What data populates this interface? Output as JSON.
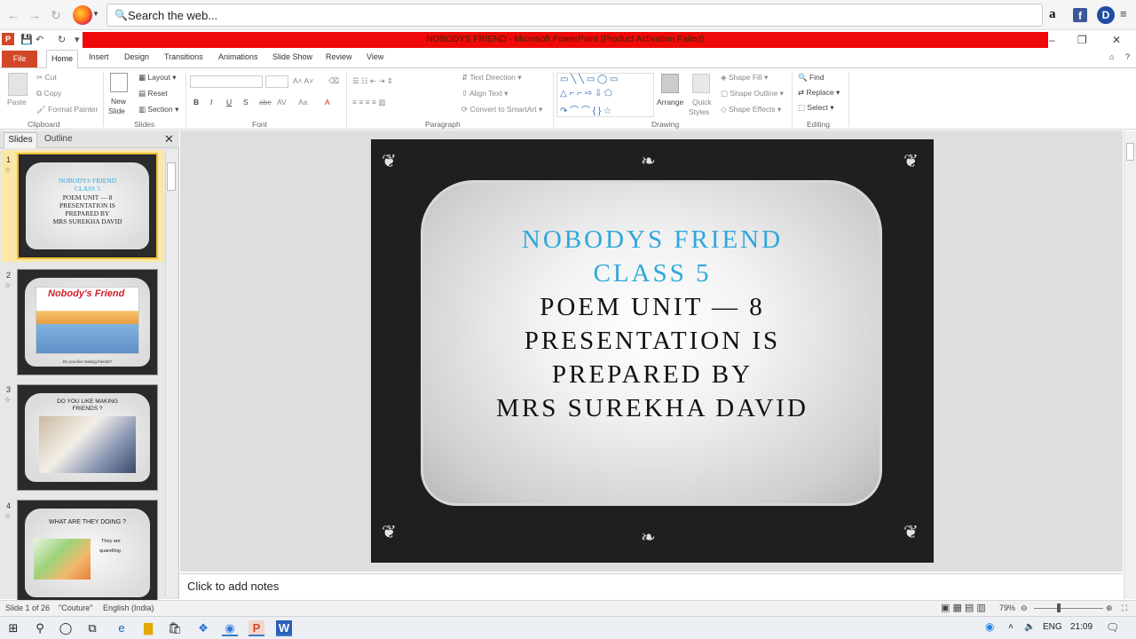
{
  "browser": {
    "search_placeholder": "Search the web...",
    "extensions": [
      "a",
      "f",
      "D"
    ]
  },
  "window": {
    "title": "NOBODYS FRIEND  -  Microsoft PowerPoint (Product Activation Failed)"
  },
  "ribbon_tabs": [
    "File",
    "Home",
    "Insert",
    "Design",
    "Transitions",
    "Animations",
    "Slide Show",
    "Review",
    "View"
  ],
  "ribbon": {
    "clipboard": {
      "paste": "Paste",
      "cut": "Cut",
      "copy": "Copy",
      "format_painter": "Format Painter",
      "label": "Clipboard"
    },
    "slides": {
      "new_slide_1": "New",
      "new_slide_2": "Slide",
      "layout": "Layout",
      "reset": "Reset",
      "section": "Section",
      "label": "Slides"
    },
    "font": {
      "label": "Font",
      "bold": "B",
      "italic": "I",
      "underline": "U",
      "strike": "S",
      "shadow": "abc"
    },
    "paragraph": {
      "text_direction": "Text Direction",
      "align_text": "Align Text",
      "convert_smartart": "Convert to SmartArt",
      "label": "Paragraph"
    },
    "drawing": {
      "arrange": "Arrange",
      "quick_styles_1": "Quick",
      "quick_styles_2": "Styles",
      "shape_fill": "Shape Fill",
      "shape_outline": "Shape Outline",
      "shape_effects": "Shape Effects",
      "label": "Drawing"
    },
    "editing": {
      "find": "Find",
      "replace": "Replace",
      "select": "Select",
      "label": "Editing"
    }
  },
  "panel": {
    "tab_slides": "Slides",
    "tab_outline": "Outline"
  },
  "thumbnails": [
    {
      "num": "1",
      "lines_blue": [
        "NOBODYS FRIEND",
        "CLASS  5"
      ],
      "lines_black": [
        "POEM  UNIT — 8",
        "PRESENTATION IS",
        "PREPARED BY",
        "MRS SUREKHA DAVID"
      ]
    },
    {
      "num": "2",
      "caption": "Nobody's Friend",
      "sub": "Do you like making friends?"
    },
    {
      "num": "3",
      "title_1": "DO YOU LIKE MAKING",
      "title_2": "FRIENDS ?"
    },
    {
      "num": "4",
      "title": "WHAT ARE THEY DOING ?",
      "text_1": "They are",
      "text_2": "quarelling ."
    }
  ],
  "slide": {
    "title_1": "NOBODYS FRIEND",
    "title_2": "CLASS    5",
    "line_1": "POEM    UNIT  —    8",
    "line_2": "PRESENTATION IS",
    "line_3": "PREPARED BY",
    "line_4": "MRS SUREKHA DAVID"
  },
  "notes": {
    "placeholder": "Click to add notes"
  },
  "status": {
    "slide_info": "Slide 1 of 26",
    "theme": "\"Couture\"",
    "language": "English (India)",
    "zoom": "79%"
  },
  "tray": {
    "lang": "ENG",
    "time": "21:09"
  }
}
